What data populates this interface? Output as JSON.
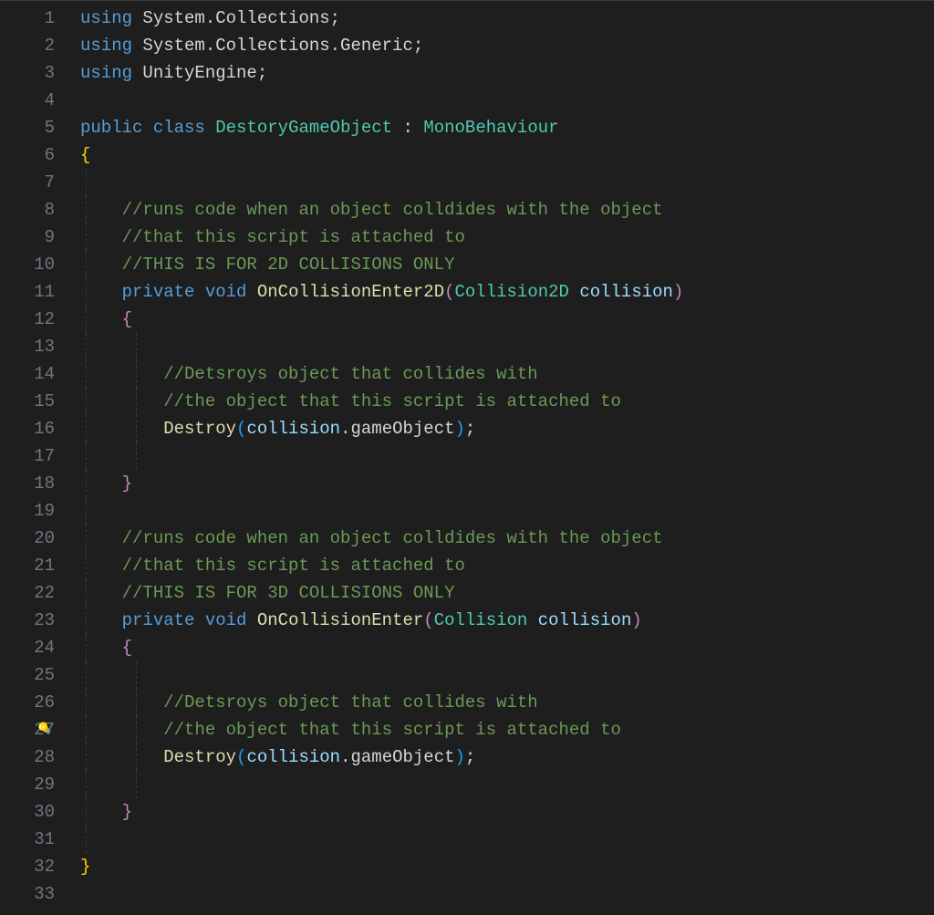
{
  "lightbulb_line": 27,
  "lines": [
    {
      "num": 1,
      "tokens": [
        [
          "kw",
          "using"
        ],
        [
          "ns",
          " System.Collections;"
        ]
      ]
    },
    {
      "num": 2,
      "tokens": [
        [
          "kw",
          "using"
        ],
        [
          "ns",
          " System.Collections.Generic;"
        ]
      ]
    },
    {
      "num": 3,
      "tokens": [
        [
          "kw",
          "using"
        ],
        [
          "ns",
          " UnityEngine;"
        ]
      ]
    },
    {
      "num": 4,
      "tokens": []
    },
    {
      "num": 5,
      "tokens": [
        [
          "kw",
          "public"
        ],
        [
          "punct",
          " "
        ],
        [
          "kw",
          "class"
        ],
        [
          "punct",
          " "
        ],
        [
          "type",
          "DestoryGameObject"
        ],
        [
          "punct",
          " : "
        ],
        [
          "type",
          "MonoBehaviour"
        ]
      ]
    },
    {
      "num": 6,
      "tokens": [
        [
          "punctY",
          "{"
        ]
      ],
      "guides": []
    },
    {
      "num": 7,
      "tokens": [],
      "guides": [
        0
      ]
    },
    {
      "num": 8,
      "indent": 1,
      "tokens": [
        [
          "comment",
          "//runs code when an object colldides with the object"
        ]
      ],
      "guides": [
        0
      ]
    },
    {
      "num": 9,
      "indent": 1,
      "tokens": [
        [
          "comment",
          "//that this script is attached to"
        ]
      ],
      "guides": [
        0
      ]
    },
    {
      "num": 10,
      "indent": 1,
      "tokens": [
        [
          "comment",
          "//THIS IS FOR 2D COLLISIONS ONLY"
        ]
      ],
      "guides": [
        0
      ]
    },
    {
      "num": 11,
      "indent": 1,
      "tokens": [
        [
          "kw",
          "private"
        ],
        [
          "punct",
          " "
        ],
        [
          "kw",
          "void"
        ],
        [
          "punct",
          " "
        ],
        [
          "method",
          "OnCollisionEnter2D"
        ],
        [
          "punctP",
          "("
        ],
        [
          "type",
          "Collision2D"
        ],
        [
          "punct",
          " "
        ],
        [
          "param",
          "collision"
        ],
        [
          "punctP",
          ")"
        ]
      ],
      "guides": [
        0
      ]
    },
    {
      "num": 12,
      "indent": 1,
      "tokens": [
        [
          "punctP",
          "{"
        ]
      ],
      "guides": [
        0
      ]
    },
    {
      "num": 13,
      "indent": 1,
      "tokens": [],
      "guides": [
        0,
        1
      ]
    },
    {
      "num": 14,
      "indent": 2,
      "tokens": [
        [
          "comment",
          "//Detsroys object that collides with"
        ]
      ],
      "guides": [
        0,
        1
      ]
    },
    {
      "num": 15,
      "indent": 2,
      "tokens": [
        [
          "comment",
          "//the object that this script is attached to"
        ]
      ],
      "guides": [
        0,
        1
      ]
    },
    {
      "num": 16,
      "indent": 2,
      "tokens": [
        [
          "method",
          "Destroy"
        ],
        [
          "punctB",
          "("
        ],
        [
          "param",
          "collision"
        ],
        [
          "punct",
          "."
        ],
        [
          "prop",
          "gameObject"
        ],
        [
          "punctB",
          ")"
        ],
        [
          "punct",
          ";"
        ]
      ],
      "guides": [
        0,
        1
      ]
    },
    {
      "num": 17,
      "indent": 1,
      "tokens": [],
      "guides": [
        0,
        1
      ]
    },
    {
      "num": 18,
      "indent": 1,
      "tokens": [
        [
          "punctP",
          "}"
        ]
      ],
      "guides": [
        0
      ]
    },
    {
      "num": 19,
      "indent": 0,
      "tokens": [],
      "guides": [
        0
      ]
    },
    {
      "num": 20,
      "indent": 1,
      "tokens": [
        [
          "comment",
          "//runs code when an object colldides with the object"
        ]
      ],
      "guides": [
        0
      ]
    },
    {
      "num": 21,
      "indent": 1,
      "tokens": [
        [
          "comment",
          "//that this script is attached to"
        ]
      ],
      "guides": [
        0
      ]
    },
    {
      "num": 22,
      "indent": 1,
      "tokens": [
        [
          "comment",
          "//THIS IS FOR 3D COLLISIONS ONLY"
        ]
      ],
      "guides": [
        0
      ]
    },
    {
      "num": 23,
      "indent": 1,
      "tokens": [
        [
          "kw",
          "private"
        ],
        [
          "punct",
          " "
        ],
        [
          "kw",
          "void"
        ],
        [
          "punct",
          " "
        ],
        [
          "method",
          "OnCollisionEnter"
        ],
        [
          "punctP",
          "("
        ],
        [
          "type",
          "Collision"
        ],
        [
          "punct",
          " "
        ],
        [
          "param",
          "collision"
        ],
        [
          "punctP",
          ")"
        ]
      ],
      "guides": [
        0
      ]
    },
    {
      "num": 24,
      "indent": 1,
      "tokens": [
        [
          "punctP",
          "{"
        ]
      ],
      "guides": [
        0
      ]
    },
    {
      "num": 25,
      "indent": 1,
      "tokens": [],
      "guides": [
        0,
        1
      ]
    },
    {
      "num": 26,
      "indent": 2,
      "tokens": [
        [
          "comment",
          "//Detsroys object that collides with"
        ]
      ],
      "guides": [
        0,
        1
      ]
    },
    {
      "num": 27,
      "indent": 2,
      "tokens": [
        [
          "comment",
          "//the object that this script is attached to"
        ]
      ],
      "guides": [
        0,
        1
      ]
    },
    {
      "num": 28,
      "indent": 2,
      "tokens": [
        [
          "method",
          "Destroy"
        ],
        [
          "punctB",
          "("
        ],
        [
          "param",
          "collision"
        ],
        [
          "punct",
          "."
        ],
        [
          "prop",
          "gameObject"
        ],
        [
          "punctB",
          ")"
        ],
        [
          "punct",
          ";"
        ]
      ],
      "guides": [
        0,
        1
      ]
    },
    {
      "num": 29,
      "indent": 1,
      "tokens": [],
      "guides": [
        0,
        1
      ]
    },
    {
      "num": 30,
      "indent": 1,
      "tokens": [
        [
          "punctP",
          "}"
        ]
      ],
      "guides": [
        0
      ]
    },
    {
      "num": 31,
      "indent": 0,
      "tokens": [],
      "guides": [
        0
      ]
    },
    {
      "num": 32,
      "tokens": [
        [
          "punctY",
          "}"
        ]
      ]
    },
    {
      "num": 33,
      "tokens": []
    }
  ]
}
